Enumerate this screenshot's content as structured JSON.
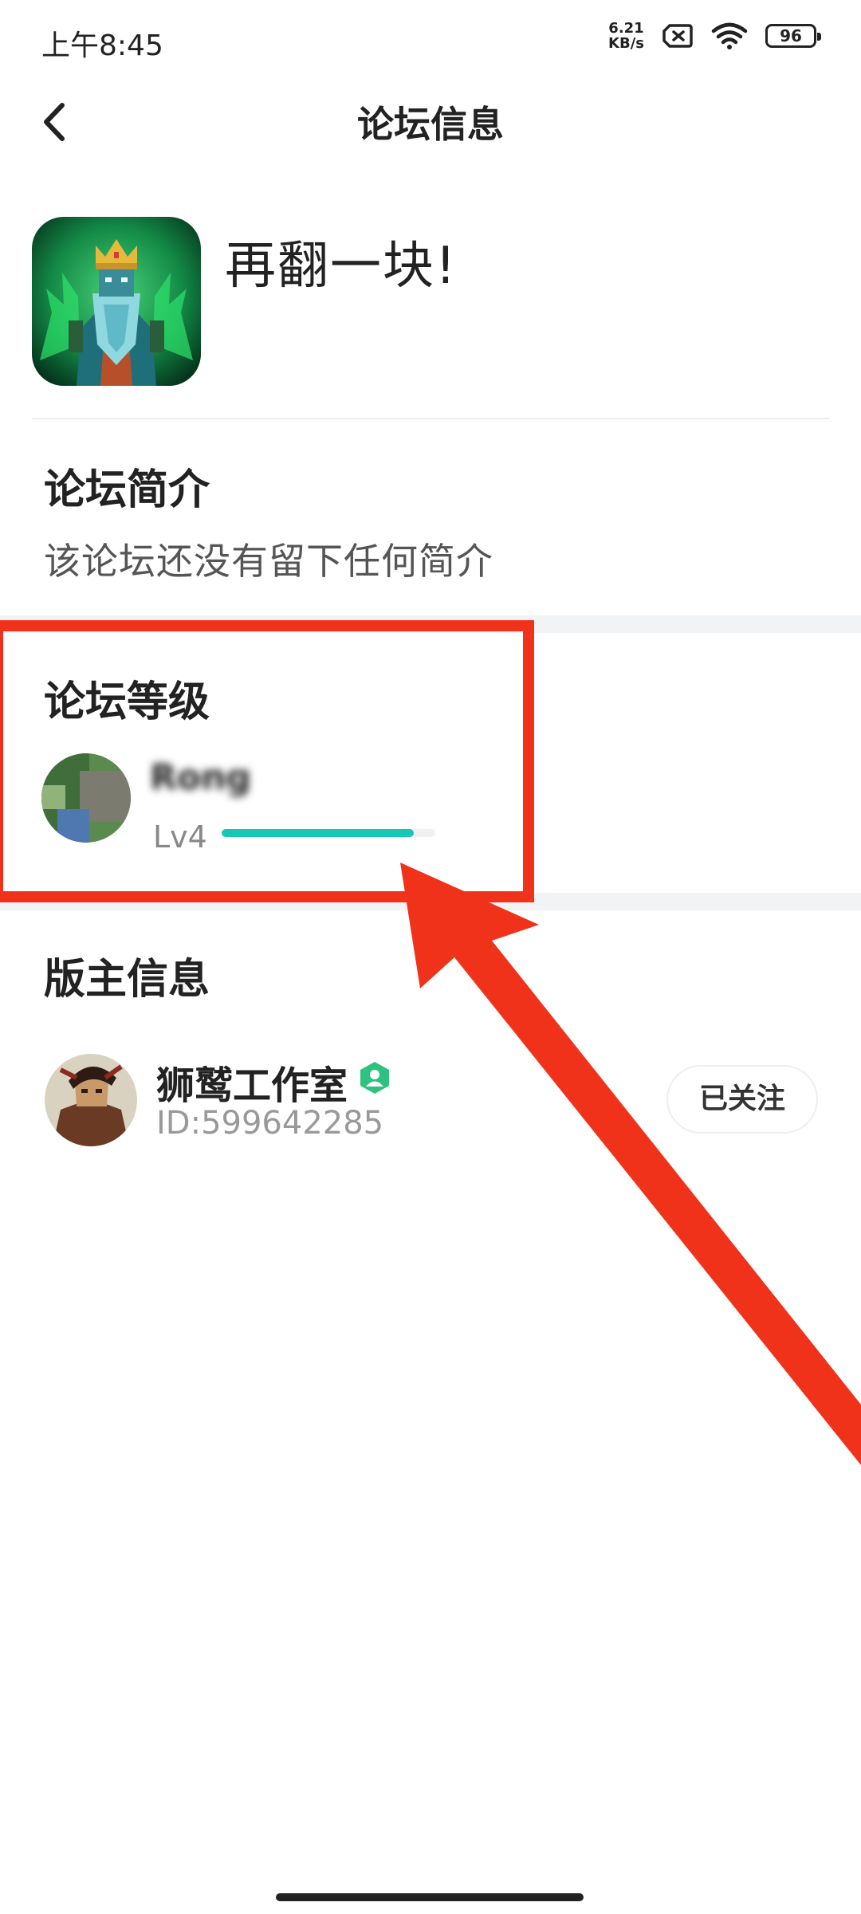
{
  "status_bar": {
    "time": "上午8:45",
    "net_speed_value": "6.21",
    "net_speed_unit": "KB/s",
    "battery_level": "96",
    "icons": [
      "sim-disabled-icon",
      "wifi-icon",
      "battery-icon"
    ]
  },
  "header": {
    "title": "论坛信息",
    "back_icon": "back-arrow-icon"
  },
  "forum": {
    "name": "再翻一块!",
    "icon": "pixel-king-game-icon"
  },
  "intro": {
    "title": "论坛简介",
    "text": "该论坛还没有留下任何简介"
  },
  "level": {
    "title": "论坛等级",
    "user_name": "Rong",
    "level_label": "Lv4",
    "progress": 0.9
  },
  "moderator": {
    "title": "版主信息",
    "name": "狮鹫工作室",
    "id_text": "ID:599642285",
    "follow_label": "已关注",
    "badge_icon": "verified-badge-icon"
  },
  "colors": {
    "accent": "#17c7b5",
    "annotation_red": "#f1321b",
    "verified_green": "#2ec27e"
  }
}
